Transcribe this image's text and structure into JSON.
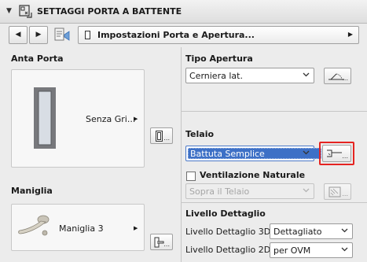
{
  "header": {
    "title": "SETTAGGI PORTA A BATTENTE",
    "collapse_icon": "triangle-down-icon",
    "panel_icon": "door-settings-icon"
  },
  "nav": {
    "prev_icon": "triangle-left-icon",
    "next_icon": "triangle-right-icon",
    "favorites_icon": "favorites-icon",
    "current_page": "Impostazioni Porta e Apertura..."
  },
  "door_leaf": {
    "label": "Anta Porta",
    "preview_text": "Senza Gri..."
  },
  "handle": {
    "label": "Maniglia",
    "preview_text": "Maniglia 3"
  },
  "opening_type": {
    "label": "Tipo Apertura",
    "value": "Cerniera lat."
  },
  "frame": {
    "label": "Telaio",
    "value": "Battuta Semplice",
    "ventilation_label": "Ventilazione Naturale",
    "ventilation_checked": false,
    "ventilation_position": "Sopra il Telaio"
  },
  "detail": {
    "label": "Livello Dettaglio",
    "level_3d_label": "Livello Dettaglio 3D",
    "level_3d_value": "Dettagliato",
    "level_2d_label": "Livello Dettaglio 2D",
    "level_2d_value": "per OVM"
  },
  "ellipsis": "...",
  "colors": {
    "highlight": "#e52421",
    "selection": "#3d70c6"
  }
}
